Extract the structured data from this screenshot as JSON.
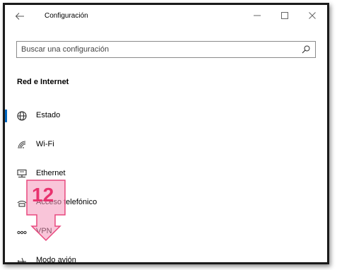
{
  "window": {
    "title": "Configuración"
  },
  "search": {
    "placeholder": "Buscar una configuración"
  },
  "section": {
    "title": "Red e Internet"
  },
  "nav": {
    "items": [
      {
        "label": "Estado",
        "icon": "globe-icon",
        "selected": true
      },
      {
        "label": "Wi-Fi",
        "icon": "wifi-icon",
        "selected": false
      },
      {
        "label": "Ethernet",
        "icon": "ethernet-icon",
        "selected": false
      },
      {
        "label": "Acceso telefónico",
        "icon": "dialup-icon",
        "selected": false
      },
      {
        "label": "VPN",
        "icon": "vpn-icon",
        "selected": false
      },
      {
        "label": "Modo avión",
        "icon": "airplane-icon",
        "selected": false
      }
    ]
  },
  "annotation": {
    "number": "12",
    "color": "#e8326e"
  },
  "colors": {
    "accent": "#0067c0"
  }
}
